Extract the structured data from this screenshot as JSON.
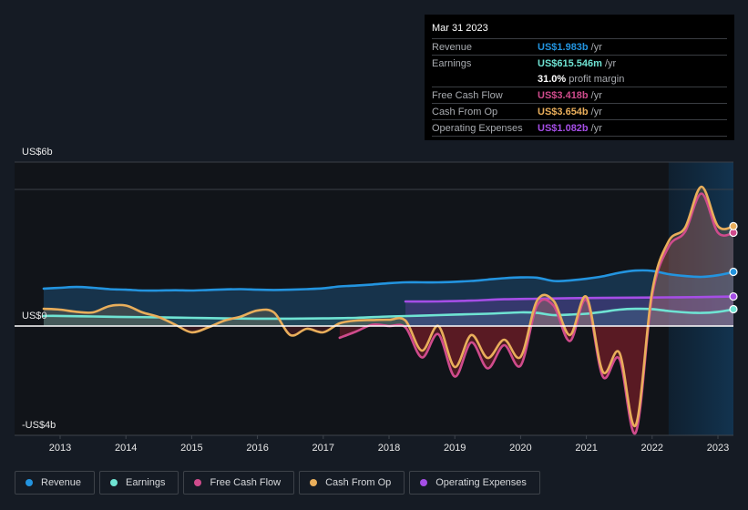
{
  "tooltip": {
    "date": "Mar 31 2023",
    "rows": [
      {
        "label": "Revenue",
        "value": "US$1.983b",
        "unit": "/yr",
        "color": "#2394df"
      },
      {
        "label": "Earnings",
        "value": "US$615.546m",
        "unit": "/yr",
        "color": "#6fe3d3"
      },
      {
        "label": "",
        "value": "31.0%",
        "unit": "profit margin",
        "color": "#ffffff"
      },
      {
        "label": "Free Cash Flow",
        "value": "US$3.418b",
        "unit": "/yr",
        "color": "#cf4b8c"
      },
      {
        "label": "Cash From Op",
        "value": "US$3.654b",
        "unit": "/yr",
        "color": "#e9ae5b"
      },
      {
        "label": "Operating Expenses",
        "value": "US$1.082b",
        "unit": "/yr",
        "color": "#a54ee6"
      }
    ]
  },
  "legend": [
    {
      "label": "Revenue",
      "color": "#2394df"
    },
    {
      "label": "Earnings",
      "color": "#6fe3d3"
    },
    {
      "label": "Free Cash Flow",
      "color": "#cf4b8c"
    },
    {
      "label": "Cash From Op",
      "color": "#e9ae5b"
    },
    {
      "label": "Operating Expenses",
      "color": "#a54ee6"
    }
  ],
  "chart_data": {
    "type": "line",
    "title": "",
    "xlabel": "",
    "ylabel": "",
    "y_unit": "US$ billions",
    "ylim": [
      -4,
      6
    ],
    "xlim": [
      2012.5,
      2023.25
    ],
    "y_tick_labels": [
      {
        "value": 6,
        "label": "US$6b"
      },
      {
        "value": 0,
        "label": "US$0"
      },
      {
        "value": -4,
        "label": "-US$4b"
      }
    ],
    "gridlines": [
      6,
      5
    ],
    "x_ticks": [
      2013,
      2014,
      2015,
      2016,
      2017,
      2018,
      2019,
      2020,
      2021,
      2022,
      2023
    ],
    "x_tick_labels": [
      "2013",
      "2014",
      "2015",
      "2016",
      "2017",
      "2018",
      "2019",
      "2020",
      "2021",
      "2022",
      "2023"
    ],
    "highlight_range": [
      2022.25,
      2023.25
    ],
    "legend_position": "bottom",
    "series": [
      {
        "name": "Revenue",
        "color": "#2394df",
        "x": [
          2012.75,
          2013.0,
          2013.25,
          2013.5,
          2013.75,
          2014.0,
          2014.25,
          2014.5,
          2014.75,
          2015.0,
          2015.25,
          2015.5,
          2015.75,
          2016.0,
          2016.25,
          2016.5,
          2016.75,
          2017.0,
          2017.25,
          2017.5,
          2017.75,
          2018.0,
          2018.25,
          2018.5,
          2018.75,
          2019.0,
          2019.25,
          2019.5,
          2019.75,
          2020.0,
          2020.25,
          2020.5,
          2020.75,
          2021.0,
          2021.25,
          2021.5,
          2021.75,
          2022.0,
          2022.25,
          2022.5,
          2022.75,
          2023.0,
          2023.25
        ],
        "values": [
          1.37,
          1.4,
          1.43,
          1.4,
          1.35,
          1.33,
          1.3,
          1.3,
          1.31,
          1.3,
          1.32,
          1.34,
          1.35,
          1.33,
          1.32,
          1.33,
          1.35,
          1.38,
          1.45,
          1.48,
          1.52,
          1.57,
          1.6,
          1.6,
          1.6,
          1.62,
          1.65,
          1.7,
          1.75,
          1.78,
          1.77,
          1.65,
          1.67,
          1.73,
          1.82,
          1.95,
          2.03,
          2.02,
          1.9,
          1.83,
          1.8,
          1.86,
          1.983
        ]
      },
      {
        "name": "Earnings",
        "color": "#6fe3d3",
        "x": [
          2012.75,
          2013.0,
          2013.5,
          2014.0,
          2014.5,
          2015.0,
          2015.5,
          2016.0,
          2016.5,
          2017.0,
          2017.5,
          2018.0,
          2018.5,
          2019.0,
          2019.5,
          2020.0,
          2020.25,
          2020.5,
          2020.75,
          2021.0,
          2021.25,
          2021.5,
          2021.75,
          2022.0,
          2022.25,
          2022.5,
          2022.75,
          2023.0,
          2023.25
        ],
        "values": [
          0.37,
          0.37,
          0.35,
          0.33,
          0.32,
          0.3,
          0.28,
          0.27,
          0.27,
          0.28,
          0.3,
          0.35,
          0.38,
          0.42,
          0.45,
          0.5,
          0.48,
          0.4,
          0.42,
          0.45,
          0.52,
          0.6,
          0.63,
          0.62,
          0.55,
          0.5,
          0.48,
          0.52,
          0.616
        ]
      },
      {
        "name": "Free Cash Flow",
        "color": "#cf4b8c",
        "x": [
          2017.25,
          2017.5,
          2017.75,
          2018.0,
          2018.25,
          2018.5,
          2018.75,
          2019.0,
          2019.25,
          2019.5,
          2019.75,
          2020.0,
          2020.25,
          2020.5,
          2020.75,
          2021.0,
          2021.25,
          2021.5,
          2021.75,
          2022.0,
          2022.25,
          2022.5,
          2022.75,
          2023.0,
          2023.25
        ],
        "values": [
          -0.43,
          -0.2,
          0.05,
          0.0,
          -0.05,
          -1.15,
          -0.3,
          -1.85,
          -0.6,
          -1.55,
          -0.7,
          -1.45,
          0.75,
          0.75,
          -0.55,
          0.95,
          -1.85,
          -1.2,
          -3.9,
          1.1,
          2.9,
          3.45,
          4.85,
          3.418,
          3.418
        ]
      },
      {
        "name": "Cash From Op",
        "color": "#e9ae5b",
        "x": [
          2012.75,
          2013.0,
          2013.25,
          2013.5,
          2013.75,
          2014.0,
          2014.25,
          2014.5,
          2014.75,
          2015.0,
          2015.25,
          2015.5,
          2015.75,
          2016.0,
          2016.25,
          2016.5,
          2016.75,
          2017.0,
          2017.25,
          2017.5,
          2017.75,
          2018.0,
          2018.25,
          2018.5,
          2018.75,
          2019.0,
          2019.25,
          2019.5,
          2019.75,
          2020.0,
          2020.25,
          2020.5,
          2020.75,
          2021.0,
          2021.25,
          2021.5,
          2021.75,
          2022.0,
          2022.25,
          2022.5,
          2022.75,
          2023.0,
          2023.25
        ],
        "values": [
          0.63,
          0.6,
          0.52,
          0.5,
          0.73,
          0.75,
          0.5,
          0.33,
          0.05,
          -0.23,
          -0.05,
          0.2,
          0.35,
          0.57,
          0.5,
          -0.33,
          -0.1,
          -0.23,
          0.1,
          0.2,
          0.22,
          0.23,
          0.2,
          -0.9,
          0.0,
          -1.5,
          -0.33,
          -1.17,
          -0.5,
          -1.13,
          0.93,
          0.93,
          -0.33,
          1.07,
          -1.67,
          -0.97,
          -3.63,
          1.27,
          3.1,
          3.6,
          5.1,
          3.654,
          3.654
        ]
      },
      {
        "name": "Operating Expenses",
        "color": "#a54ee6",
        "x": [
          2018.25,
          2018.75,
          2019.25,
          2019.75,
          2020.25,
          2020.75,
          2021.25,
          2021.75,
          2022.25,
          2022.75,
          2023.25
        ],
        "values": [
          0.9,
          0.9,
          0.93,
          0.98,
          1.0,
          1.02,
          1.03,
          1.04,
          1.05,
          1.06,
          1.082
        ]
      }
    ]
  }
}
